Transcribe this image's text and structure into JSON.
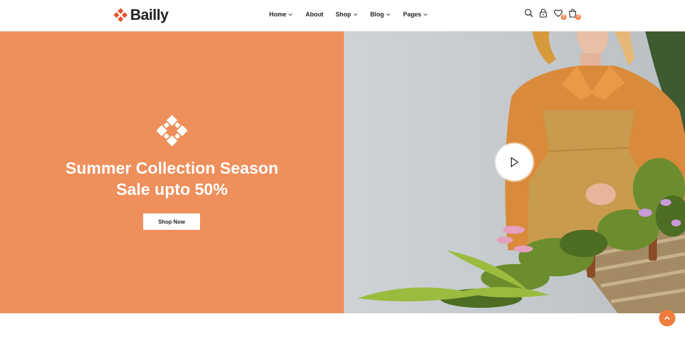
{
  "brand": {
    "name": "Bailly",
    "accent": "#ef8f5b"
  },
  "nav": {
    "items": [
      {
        "label": "Home",
        "has_dropdown": true
      },
      {
        "label": "About",
        "has_dropdown": false
      },
      {
        "label": "Shop",
        "has_dropdown": true
      },
      {
        "label": "Blog",
        "has_dropdown": true
      },
      {
        "label": "Pages",
        "has_dropdown": true
      }
    ]
  },
  "header_icons": {
    "search": "search-icon",
    "account": "lock-icon",
    "wishlist": {
      "icon": "heart-icon",
      "count": "0"
    },
    "cart": {
      "icon": "bag-icon",
      "count": "0"
    }
  },
  "hero": {
    "title_line1": "Summer Collection Season",
    "title_line2": "Sale upto 50%",
    "cta_label": "Shop Now",
    "bg_color": "#ef8f5b",
    "play_icon": "play-icon"
  },
  "scroll_top_icon": "chevron-up-icon"
}
